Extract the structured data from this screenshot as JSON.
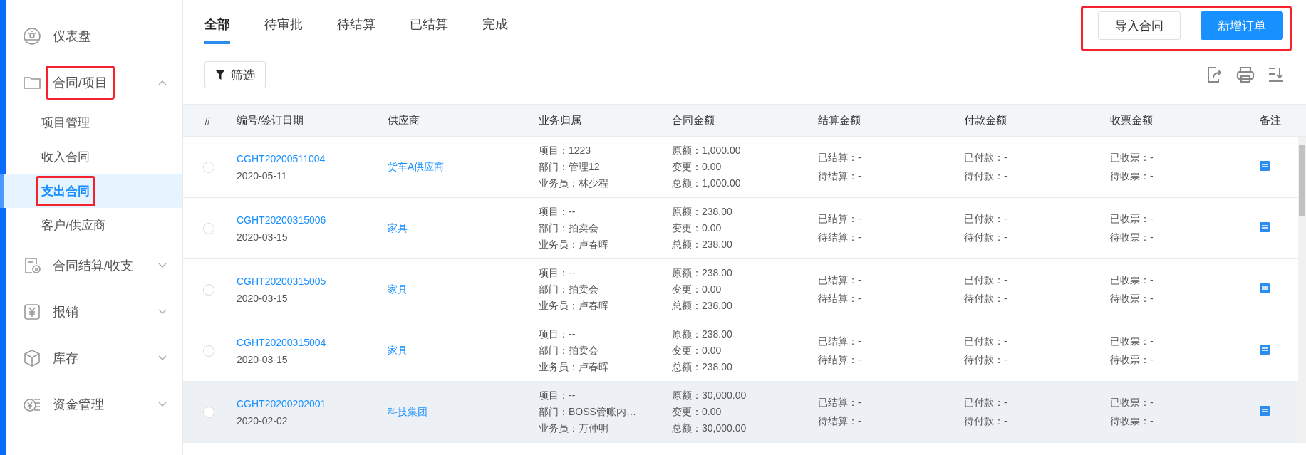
{
  "sidebar": {
    "items": [
      {
        "label": "仪表盘",
        "highlighted": false
      },
      {
        "label": "合同/项目",
        "expanded": true,
        "highlighted": true,
        "children": [
          {
            "label": "项目管理",
            "selected": false,
            "highlighted": false
          },
          {
            "label": "收入合同",
            "selected": false,
            "highlighted": false
          },
          {
            "label": "支出合同",
            "selected": true,
            "highlighted": true
          },
          {
            "label": "客户/供应商",
            "selected": false,
            "highlighted": false
          }
        ]
      },
      {
        "label": "合同结算/收支",
        "expanded": false,
        "highlighted": false
      },
      {
        "label": "报销",
        "expanded": false,
        "highlighted": false
      },
      {
        "label": "库存",
        "expanded": false,
        "highlighted": false
      },
      {
        "label": "资金管理",
        "expanded": false,
        "highlighted": false
      }
    ]
  },
  "tabs": [
    {
      "label": "全部",
      "selected": true
    },
    {
      "label": "待审批",
      "selected": false
    },
    {
      "label": "待结算",
      "selected": false
    },
    {
      "label": "已结算",
      "selected": false
    },
    {
      "label": "完成",
      "selected": false
    }
  ],
  "actions": {
    "highlighted": true,
    "buttons": [
      {
        "label": "导入合同",
        "kind": "default"
      },
      {
        "label": "新增订单",
        "kind": "primary"
      }
    ]
  },
  "filter_button": "筛选",
  "table": {
    "columns": [
      "#",
      "编号/签订日期",
      "供应商",
      "业务归属",
      "合同金额",
      "结算金额",
      "付款金额",
      "收票金额",
      "备注"
    ],
    "rows": [
      {
        "selected": false,
        "hovered": false,
        "number": "CGHT20200511004",
        "date": "2020-05-11",
        "supplier": "货车A供应商",
        "business": [
          "项目：1223",
          "部门：管理12",
          "业务员：林少程"
        ],
        "amount": [
          "原额：1,000.00",
          "变更：0.00",
          "总额：1,000.00"
        ],
        "settle": [
          "已结算：-",
          "待结算：-"
        ],
        "pay": [
          "已付款：-",
          "待付款：-"
        ],
        "invoice": [
          "已收票：-",
          "待收票：-"
        ],
        "note": true
      },
      {
        "selected": false,
        "hovered": false,
        "number": "CGHT20200315006",
        "date": "2020-03-15",
        "supplier": "家具",
        "business": [
          "项目：--",
          "部门：拍卖会",
          "业务员：卢春晖"
        ],
        "amount": [
          "原额：238.00",
          "变更：0.00",
          "总额：238.00"
        ],
        "settle": [
          "已结算：-",
          "待结算：-"
        ],
        "pay": [
          "已付款：-",
          "待付款：-"
        ],
        "invoice": [
          "已收票：-",
          "待收票：-"
        ],
        "note": true
      },
      {
        "selected": false,
        "hovered": false,
        "number": "CGHT20200315005",
        "date": "2020-03-15",
        "supplier": "家具",
        "business": [
          "项目：--",
          "部门：拍卖会",
          "业务员：卢春晖"
        ],
        "amount": [
          "原额：238.00",
          "变更：0.00",
          "总额：238.00"
        ],
        "settle": [
          "已结算：-",
          "待结算：-"
        ],
        "pay": [
          "已付款：-",
          "待付款：-"
        ],
        "invoice": [
          "已收票：-",
          "待收票：-"
        ],
        "note": true
      },
      {
        "selected": false,
        "hovered": false,
        "number": "CGHT20200315004",
        "date": "2020-03-15",
        "supplier": "家具",
        "business": [
          "项目：--",
          "部门：拍卖会",
          "业务员：卢春晖"
        ],
        "amount": [
          "原额：238.00",
          "变更：0.00",
          "总额：238.00"
        ],
        "settle": [
          "已结算：-",
          "待结算：-"
        ],
        "pay": [
          "已付款：-",
          "待付款：-"
        ],
        "invoice": [
          "已收票：-",
          "待收票：-"
        ],
        "note": true
      },
      {
        "selected": false,
        "hovered": true,
        "number": "CGHT20200202001",
        "date": "2020-02-02",
        "supplier": "科技集团",
        "business": [
          "项目：--",
          "部门：BOSS管账内…",
          "业务员：万仲明"
        ],
        "amount": [
          "原额：30,000.00",
          "变更：0.00",
          "总额：30,000.00"
        ],
        "settle": [
          "已结算：-",
          "待结算：-"
        ],
        "pay": [
          "已付款：-",
          "待付款：-"
        ],
        "invoice": [
          "已收票：-",
          "待收票：-"
        ],
        "note": true
      }
    ]
  }
}
